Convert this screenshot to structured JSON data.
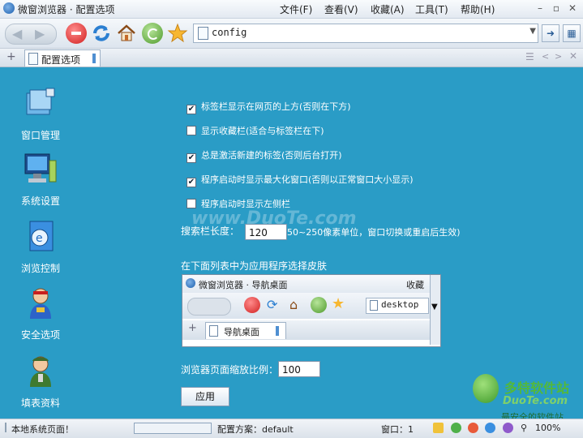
{
  "window": {
    "title": "微窗浏览器 · 配置选项"
  },
  "menu": [
    "文件(F)",
    "查看(V)",
    "收藏(A)",
    "工具(T)",
    "帮助(H)"
  ],
  "address": {
    "value": "config"
  },
  "tabs": [
    {
      "label": "配置选项"
    }
  ],
  "sidebar": [
    {
      "label": "窗口管理",
      "icon": "window-manage-icon"
    },
    {
      "label": "系统设置",
      "icon": "system-settings-icon"
    },
    {
      "label": "浏览控制",
      "icon": "browse-control-icon"
    },
    {
      "label": "安全选项",
      "icon": "security-icon"
    },
    {
      "label": "填表资料",
      "icon": "form-fill-icon"
    }
  ],
  "options": [
    {
      "label": "标签栏显示在网页的上方(否则在下方)",
      "checked": true
    },
    {
      "label": "显示收藏栏(适合与标签栏在下)",
      "checked": false
    },
    {
      "label": "总是激活新建的标签(否则后台打开)",
      "checked": true
    },
    {
      "label": "程序启动时显示最大化窗口(否则以正常窗口大小显示)",
      "checked": true
    },
    {
      "label": "程序启动时显示左侧栏",
      "checked": false
    }
  ],
  "search_length": {
    "label": "搜索栏长度：",
    "value": "120",
    "hint": "50~250像素单位，窗口切换或重启后生效)"
  },
  "skin": {
    "heading": "在下面列表中为应用程序选择皮肤",
    "preview_title": "微窗浏览器 · 导航桌面",
    "preview_menu": "收藏",
    "preview_address": "desktop",
    "preview_tab": "导航桌面"
  },
  "zoom": {
    "label": "浏览器页面缩放比例：",
    "value": "100"
  },
  "apply_label": "应用",
  "statusbar": {
    "page": "本地系统页面！",
    "scheme": "配置方案：default",
    "windows": "窗口：1",
    "zoom": "100%"
  },
  "watermarks": [
    "www.DuoTe.com",
    "多特软件站",
    "DuoTe.com",
    "最安全的软件站"
  ]
}
